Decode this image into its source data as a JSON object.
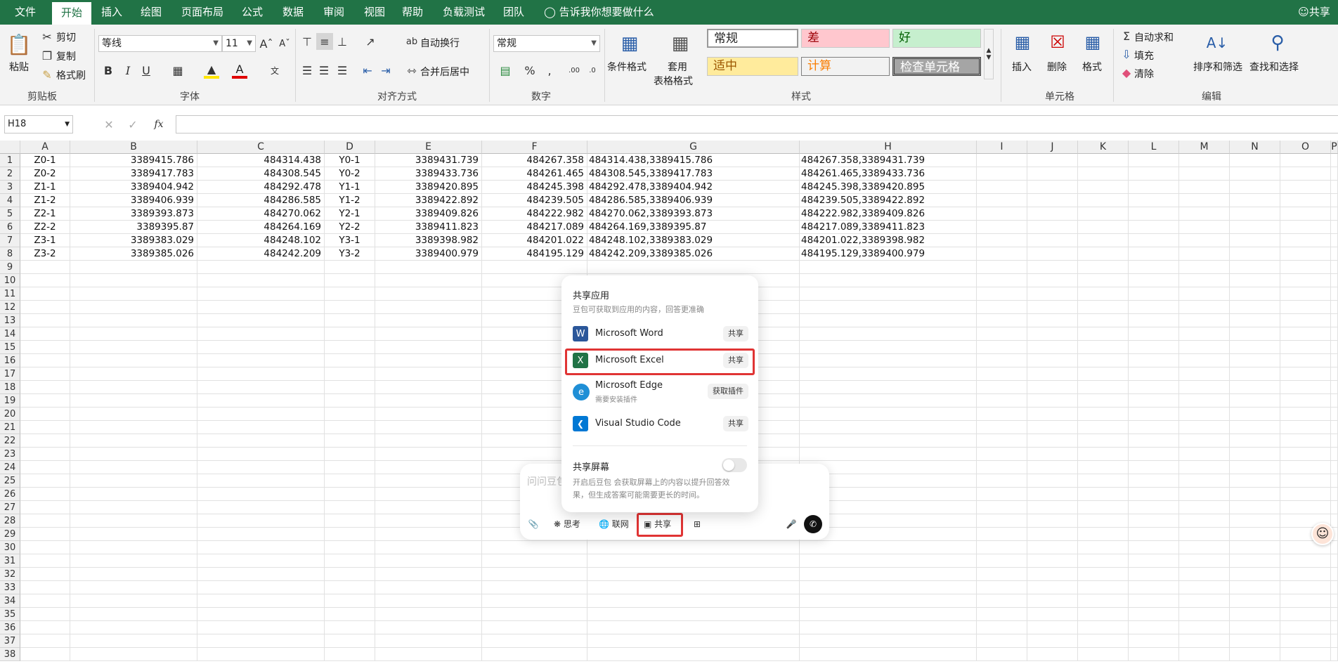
{
  "menu": {
    "items": [
      "文件",
      "开始",
      "插入",
      "绘图",
      "页面布局",
      "公式",
      "数据",
      "审阅",
      "视图",
      "帮助",
      "负载测试",
      "团队"
    ],
    "tell_me": "告诉我你想要做什么",
    "share": "共享"
  },
  "ribbon": {
    "clipboard": {
      "paste": "粘贴",
      "cut": "剪切",
      "copy": "复制",
      "format_painter": "格式刷",
      "label": "剪贴板"
    },
    "font": {
      "name": "等线",
      "size": "11",
      "label": "字体",
      "bold": "B",
      "italic": "I",
      "underline": "U"
    },
    "alignment": {
      "wrap": "自动换行",
      "merge": "合并后居中",
      "label": "对齐方式"
    },
    "number": {
      "format": "常规",
      "percent": "%",
      "comma": ",",
      "label": "数字"
    },
    "styles": {
      "conditional": "条件格式",
      "table_l1": "套用",
      "table_l2": "表格格式",
      "cells": [
        "常规",
        "差",
        "好",
        "适中",
        "计算",
        "检查单元格"
      ],
      "label": "样式"
    },
    "cells": {
      "insert": "插入",
      "delete": "删除",
      "format": "格式",
      "label": "单元格"
    },
    "editing": {
      "autosum": "自动求和",
      "fill": "填充",
      "clear": "清除",
      "sort": "排序和筛选",
      "find": "查找和选择",
      "label": "编辑"
    }
  },
  "formula_bar": {
    "name_box": "H18",
    "fx": "fx",
    "value": ""
  },
  "sheet": {
    "columns": [
      "A",
      "B",
      "C",
      "D",
      "E",
      "F",
      "G",
      "H",
      "I",
      "J",
      "K",
      "L",
      "M",
      "N",
      "O",
      "P"
    ],
    "row_numbers": [
      "1",
      "2",
      "3",
      "4",
      "5",
      "6",
      "7",
      "8",
      "9",
      "10",
      "11",
      "12",
      "13",
      "14",
      "15",
      "16",
      "17",
      "18",
      "19",
      "20",
      "21",
      "22",
      "23",
      "24",
      "25",
      "26",
      "27",
      "28",
      "29",
      "30",
      "31",
      "32",
      "33",
      "34",
      "35",
      "36",
      "37",
      "38"
    ],
    "rows": [
      [
        "Z0-1",
        "3389415.786",
        "484314.438",
        "Y0-1",
        "3389431.739",
        "484267.358",
        "484314.438,3389415.786",
        "484267.358,3389431.739"
      ],
      [
        "Z0-2",
        "3389417.783",
        "484308.545",
        "Y0-2",
        "3389433.736",
        "484261.465",
        "484308.545,3389417.783",
        "484261.465,3389433.736"
      ],
      [
        "Z1-1",
        "3389404.942",
        "484292.478",
        "Y1-1",
        "3389420.895",
        "484245.398",
        "484292.478,3389404.942",
        "484245.398,3389420.895"
      ],
      [
        "Z1-2",
        "3389406.939",
        "484286.585",
        "Y1-2",
        "3389422.892",
        "484239.505",
        "484286.585,3389406.939",
        "484239.505,3389422.892"
      ],
      [
        "Z2-1",
        "3389393.873",
        "484270.062",
        "Y2-1",
        "3389409.826",
        "484222.982",
        "484270.062,3389393.873",
        "484222.982,3389409.826"
      ],
      [
        "Z2-2",
        "3389395.87",
        "484264.169",
        "Y2-2",
        "3389411.823",
        "484217.089",
        "484264.169,3389395.87",
        "484217.089,3389411.823"
      ],
      [
        "Z3-1",
        "3389383.029",
        "484248.102",
        "Y3-1",
        "3389398.982",
        "484201.022",
        "484248.102,3389383.029",
        "484201.022,3389398.982"
      ],
      [
        "Z3-2",
        "3389385.026",
        "484242.209",
        "Y3-2",
        "3389400.979",
        "484195.129",
        "484242.209,3389385.026",
        "484195.129,3389400.979"
      ]
    ]
  },
  "share_popup": {
    "title": "共享应用",
    "subtitle": "豆包可获取到应用的内容，回答更准确",
    "apps": [
      {
        "name": "Microsoft Word",
        "action": "共享"
      },
      {
        "name": "Microsoft Excel",
        "action": "共享"
      },
      {
        "name": "Microsoft Edge",
        "sub": "需要安装插件",
        "action": "获取插件"
      },
      {
        "name": "Visual Studio Code",
        "action": "共享"
      }
    ],
    "screen_title": "共享屏幕",
    "screen_desc_1": "开启后豆包 会获取屏幕上的内容以提升回答效",
    "screen_desc_2": "果，但生成答案可能需要更长的时间。"
  },
  "chat": {
    "placeholder": "问问豆包",
    "chips": {
      "think": "思考",
      "web": "联网",
      "share": "共享"
    }
  },
  "colors": {
    "excel_green": "#217346",
    "highlight_red": "#e03434"
  }
}
